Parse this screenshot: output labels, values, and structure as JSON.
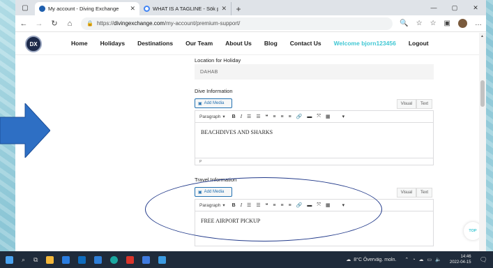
{
  "browser": {
    "tabs": [
      {
        "title": "My account - Diving Exchange",
        "active": true
      },
      {
        "title": "WHAT IS A TAGLINE - Sök på Go",
        "active": false
      }
    ],
    "url_prefix": "https://",
    "url_domain": "divingexchange.com",
    "url_path": "/my-account/premium-support/"
  },
  "site": {
    "logo_text": "DX",
    "nav": [
      "Home",
      "Holidays",
      "Destinations",
      "Our Team",
      "About Us",
      "Blog",
      "Contact Us"
    ],
    "welcome": "Welcome bjorn123456",
    "logout": "Logout",
    "top_button": "TOP"
  },
  "form": {
    "location_label": "Location for Holiday",
    "location_value": "DAHAB",
    "dive_label": "Dive Information",
    "dive_content": "BEACHDIVES AND SHARKS",
    "dive_status": "P",
    "travel_label": "Travel Information",
    "travel_content": "FREE AIRPORT PICKUP",
    "add_media": "Add Media",
    "mode_visual": "Visual",
    "mode_text": "Text",
    "format": "Paragraph"
  },
  "taskbar": {
    "weather": "8°C Överväg. moln.",
    "time": "14:46",
    "date": "2022-04-15"
  },
  "colors": {
    "accent": "#3fc7d3",
    "annotation": "#223a8a",
    "arrow": "#2e6fc4"
  }
}
